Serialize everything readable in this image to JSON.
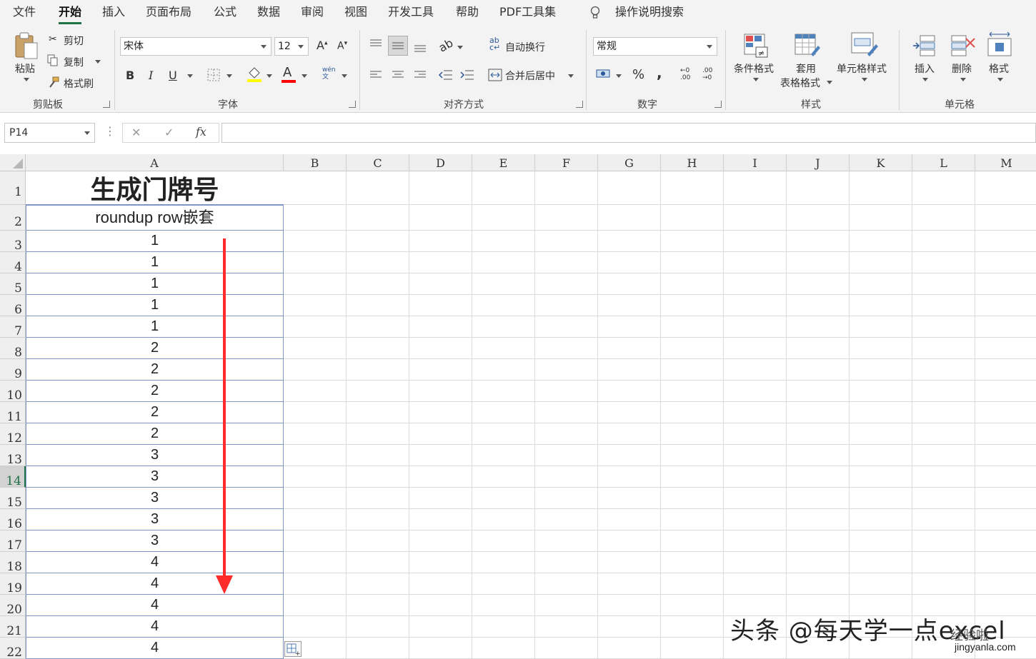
{
  "menu": {
    "tabs": [
      "文件",
      "开始",
      "插入",
      "页面布局",
      "公式",
      "数据",
      "审阅",
      "视图",
      "开发工具",
      "帮助",
      "PDF工具集"
    ],
    "active_tab": "开始",
    "tell_me": "操作说明搜索"
  },
  "ribbon": {
    "clipboard": {
      "paste": "粘贴",
      "cut": "剪切",
      "copy": "复制",
      "format_painter": "格式刷",
      "label": "剪贴板"
    },
    "font": {
      "name": "宋体",
      "size": "12",
      "bold": "B",
      "italic": "I",
      "underline": "U",
      "font_color_glyph": "A",
      "phonetic_glyph": "wén\n文",
      "label": "字体"
    },
    "alignment": {
      "wrap_text": "自动换行",
      "merge_center": "合并后居中",
      "label": "对齐方式"
    },
    "number": {
      "format": "常规",
      "percent": "%",
      "comma": ",",
      "inc_decimal": "←0\n.00",
      "dec_decimal": ".00\n→0",
      "label": "数字"
    },
    "styles": {
      "conditional": "条件格式",
      "table_format_line1": "套用",
      "table_format_line2": "表格格式",
      "cell_styles": "单元格样式",
      "label": "样式"
    },
    "cells": {
      "insert": "插入",
      "delete": "删除",
      "format": "格式",
      "label": "单元格"
    },
    "colors": {
      "accent": "#217346",
      "highlight_yellow": "#ffff00",
      "font_red": "#ff0000"
    }
  },
  "formula_bar": {
    "name_box": "P14",
    "cancel": "✕",
    "enter": "✓",
    "fx": "fx",
    "value": ""
  },
  "sheet": {
    "columns": [
      "A",
      "B",
      "C",
      "D",
      "E",
      "F",
      "G",
      "H",
      "I",
      "J",
      "K",
      "L",
      "M"
    ],
    "rows": [
      "1",
      "2",
      "3",
      "4",
      "5",
      "6",
      "7",
      "8",
      "9",
      "10",
      "11",
      "12",
      "13",
      "14",
      "15",
      "16",
      "17",
      "18",
      "19",
      "20",
      "21",
      "22"
    ],
    "selected_row": "14",
    "a1": "生成门牌号",
    "a2": "roundup  row嵌套",
    "values": [
      "1",
      "1",
      "1",
      "1",
      "1",
      "2",
      "2",
      "2",
      "2",
      "2",
      "3",
      "3",
      "3",
      "3",
      "3",
      "4",
      "4",
      "4",
      "4",
      "4"
    ]
  },
  "annotation": {
    "arrow_color": "#ff2a2a"
  },
  "watermark": {
    "text": "头条 @每天学一点excel",
    "site": "jingyanla.com",
    "logo_text": "经验啦"
  }
}
